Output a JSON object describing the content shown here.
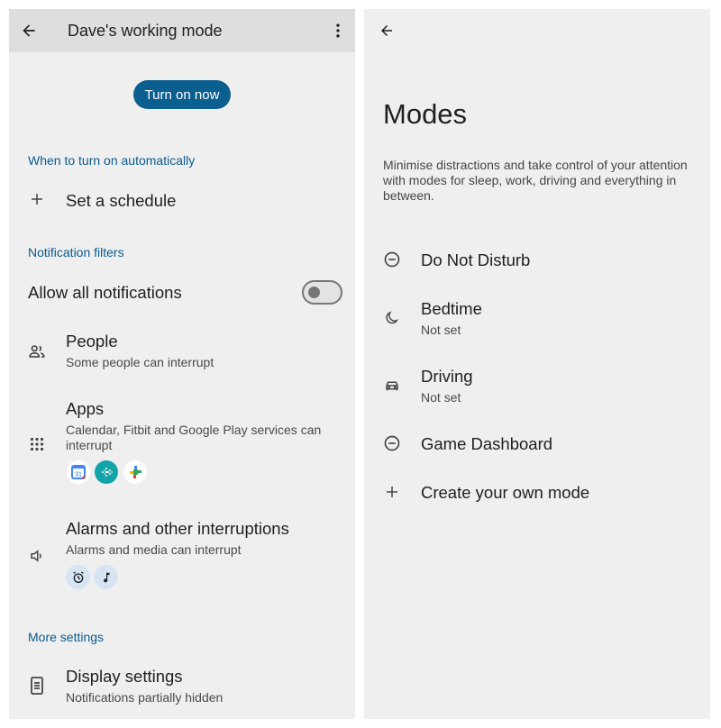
{
  "left": {
    "header": {
      "title": "Dave's working mode"
    },
    "turn_on_label": "Turn on now",
    "auto_section": "When to turn on automatically",
    "schedule_label": "Set a schedule",
    "filters_section": "Notification filters",
    "allow_all": {
      "label": "Allow all notifications",
      "enabled": false
    },
    "people": {
      "title": "People",
      "subtitle": "Some people can interrupt"
    },
    "apps": {
      "title": "Apps",
      "subtitle_line1": "Calendar, Fitbit and Google Play services can",
      "subtitle_line2": "interrupt",
      "icons": [
        "calendar-app-icon",
        "fitbit-app-icon",
        "play-services-app-icon"
      ],
      "calendar_day": "31"
    },
    "alarms": {
      "title": "Alarms and other interruptions",
      "subtitle": "Alarms and media can interrupt",
      "icons": [
        "alarm-icon",
        "music-note-icon"
      ]
    },
    "more_section": "More settings",
    "display": {
      "title": "Display settings",
      "subtitle": "Notifications partially hidden"
    }
  },
  "right": {
    "title": "Modes",
    "description": "Minimise distractions and take control of your attention with modes for sleep, work, driving and everything in between.",
    "modes": [
      {
        "name": "Do Not Disturb",
        "status": "",
        "icon": "do-not-disturb-icon"
      },
      {
        "name": "Bedtime",
        "status": "Not set",
        "icon": "moon-icon"
      },
      {
        "name": "Driving",
        "status": "Not set",
        "icon": "car-icon"
      },
      {
        "name": "Game Dashboard",
        "status": "",
        "icon": "do-not-disturb-icon"
      },
      {
        "name": "Create your own mode",
        "status": "",
        "icon": "plus-icon"
      }
    ]
  },
  "colors": {
    "accent": "#0b5f8f",
    "section_text": "#0a5a8f",
    "panel_bg": "#efefef",
    "header_bg": "#dedede"
  }
}
